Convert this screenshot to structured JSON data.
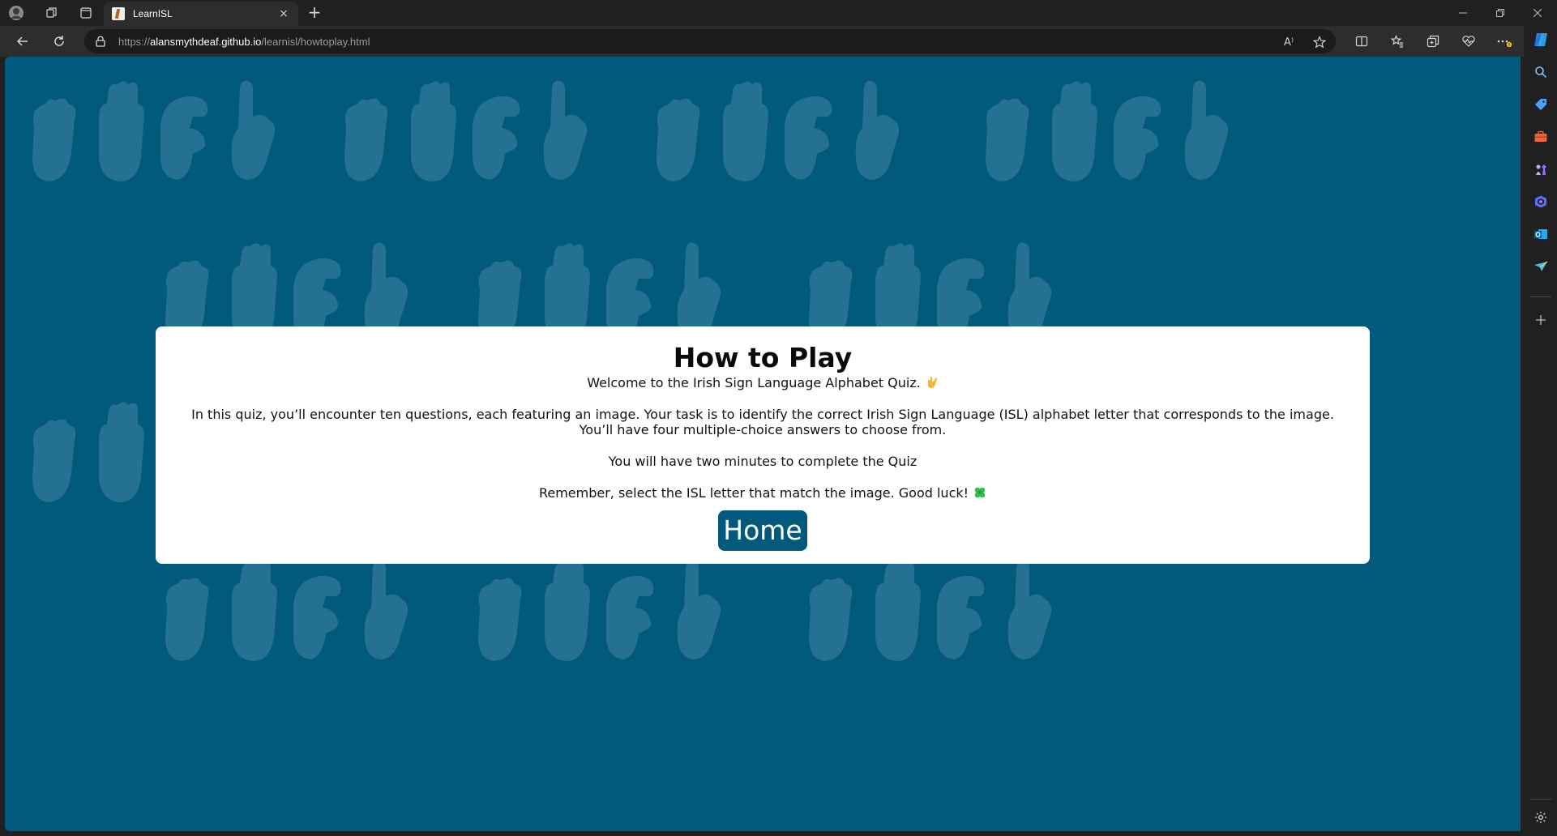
{
  "browser": {
    "tab_title": "LearnISL",
    "tab_close": "×",
    "new_tab": "+",
    "url_prefix": "https://",
    "url_host": "alansmythdeaf.github.io",
    "url_path": "/learnisl/howtoplay.html",
    "read_aloud": "A⁾"
  },
  "page": {
    "title": "How to Play",
    "welcome": "Welcome to the Irish Sign Language Alphabet Quiz.",
    "intro": "In this quiz, you’ll encounter ten questions, each featuring an image. Your task is to identify the correct Irish Sign Language (ISL) alphabet letter that corresponds to the image. You’ll have four multiple-choice answers to choose from.",
    "time_limit": "You will have two minutes to complete the Quiz",
    "remember": "Remember, select the ISL letter that match the image. Good luck!",
    "home_button": "Home"
  },
  "colors": {
    "page_background": "#015a7c",
    "card_background": "#ffffff",
    "button_background": "#015a7c",
    "hand_pattern": "#2a7596"
  }
}
